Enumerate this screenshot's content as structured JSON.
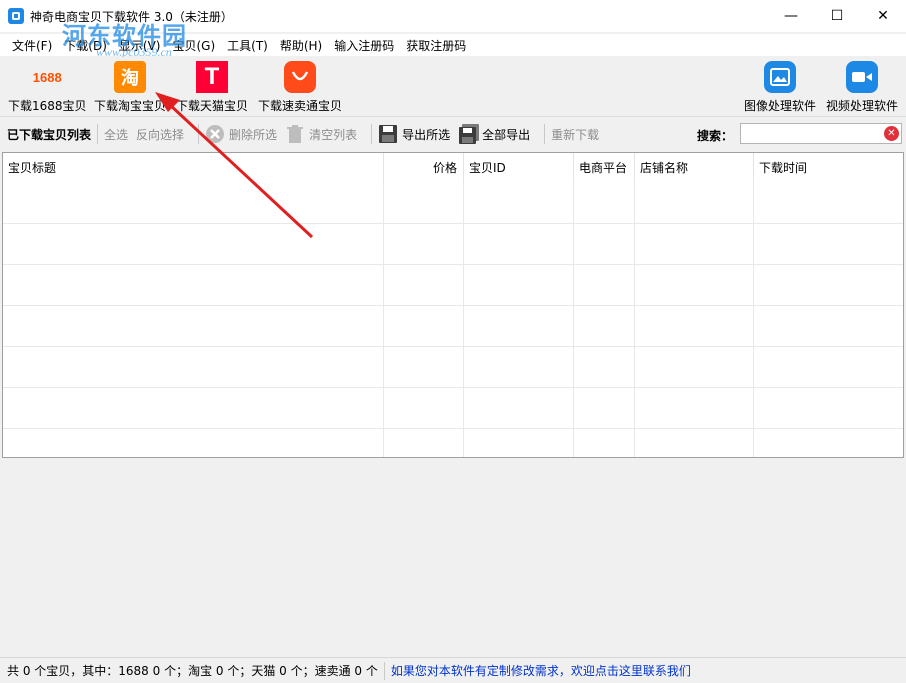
{
  "window": {
    "title": "神奇电商宝贝下载软件 3.0（未注册）",
    "minimize": "—",
    "maximize": "☐",
    "close": "✕"
  },
  "watermark": {
    "text": "河东软件园",
    "url": "www.pc0359.cn"
  },
  "menu": [
    {
      "label": "文件(F)"
    },
    {
      "label": "下载(D)"
    },
    {
      "label": "显示(V)"
    },
    {
      "label": "宝贝(G)"
    },
    {
      "label": "工具(T)"
    },
    {
      "label": "帮助(H)"
    },
    {
      "label": "输入注册码"
    },
    {
      "label": "获取注册码"
    }
  ],
  "bigbar": {
    "btn_1688": {
      "icon_text": "1688",
      "label": "下载1688宝贝"
    },
    "btn_taobao": {
      "icon_text": "淘",
      "label": "下载淘宝宝贝"
    },
    "btn_tmall": {
      "icon_text": "T",
      "label": "下载天猫宝贝"
    },
    "btn_aliexpress": {
      "label": "下载速卖通宝贝"
    },
    "btn_image": {
      "label": "图像处理软件"
    },
    "btn_video": {
      "label": "视频处理软件"
    }
  },
  "toolbar": {
    "title": "已下载宝贝列表",
    "select_all": "全选",
    "invert_select": "反向选择",
    "delete_selected": "删除所选",
    "clear_list": "清空列表",
    "export_selected": "导出所选",
    "export_all": "全部导出",
    "redownload": "重新下载",
    "search_label": "搜索：",
    "search_value": ""
  },
  "table": {
    "columns": [
      "宝贝标题",
      "价格",
      "宝贝ID",
      "电商平台",
      "店铺名称",
      "下载时间"
    ],
    "rows": []
  },
  "status": {
    "summary": "共 0 个宝贝，其中：1688 0 个；淘宝 0 个；天猫 0 个；速卖通 0 个",
    "link": "如果您对本软件有定制修改需求，欢迎点击这里联系我们"
  },
  "colors": {
    "accent": "#1e88e5",
    "taobao": "#ff8a00",
    "tmall": "#ff0036",
    "aliexpress": "#ff4a1a",
    "link": "#0033cc",
    "annotation_arrow": "#e02020"
  }
}
